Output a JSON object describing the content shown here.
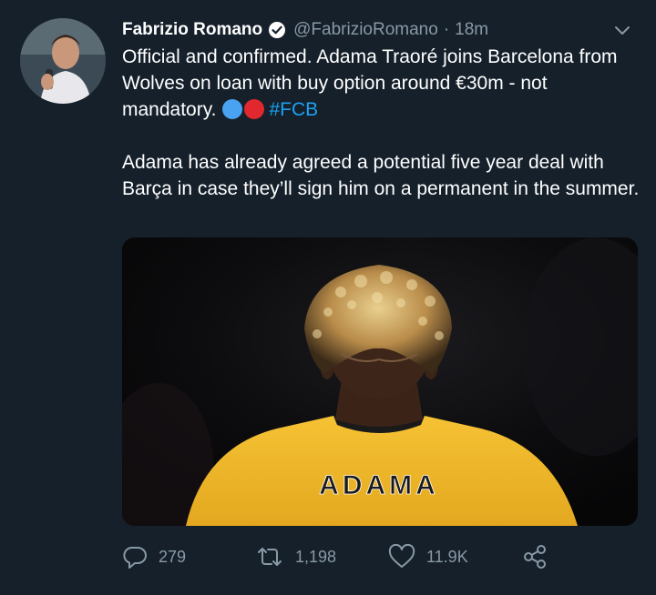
{
  "tweet": {
    "author_name": "Fabrizio Romano",
    "handle": "@FabrizioRomano",
    "separator": "·",
    "time": "18m",
    "text_part1": "Official and confirmed. Adama Traoré joins Barcelona from Wolves on loan with buy option around €30m - not mandatory.",
    "hashtag": "#FCB",
    "text_part2": "Adama has already agreed a potential five year deal with Barça in case they’ll sign him on a permanent in the summer.",
    "media": {
      "jersey_text": "ADAMA"
    },
    "actions": {
      "replies": "279",
      "retweets": "1,198",
      "likes": "11.9K"
    }
  },
  "colors": {
    "background": "#15202b",
    "secondary_text": "#8899a6",
    "accent": "#1da1f2",
    "jersey": "#f2b92a"
  }
}
